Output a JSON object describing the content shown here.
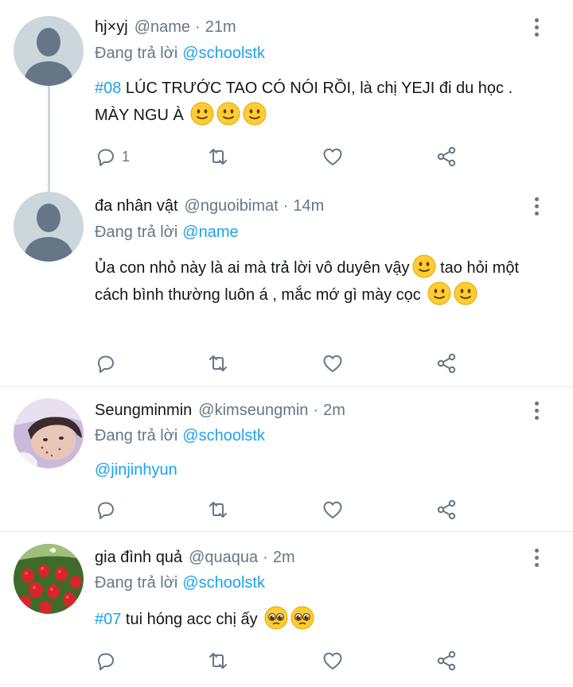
{
  "colors": {
    "accent": "#1da1f2",
    "secondary": "#657786",
    "divider": "#e6ecf0"
  },
  "tweets": [
    {
      "name": "hj×yj",
      "handle": "@name",
      "sep": "·",
      "time": "21m",
      "reply_prefix": "Đang trả lời",
      "reply_to": "@schoolstk",
      "tag": "#08",
      "text": " LÚC TRƯỚC TAO CÓ NÓI RỒI,  là chị YEJI đi du học .  MÀY NGU À ",
      "emojis": [
        "slightly-smiling-face",
        "slightly-smiling-face",
        "slightly-smiling-face"
      ],
      "reply_count": "1",
      "avatar": "default-avatar"
    },
    {
      "name": "đa nhân vật",
      "handle": "@nguoibimat",
      "sep": "·",
      "time": "14m",
      "reply_prefix": "Đang trả lời",
      "reply_to": "@name",
      "text_1": "Ủa con nhỏ này là ai mà trả lời vô duyên vậy",
      "text_2": "  tao hỏi một cách bình thường luôn á ,  mắc mớ gì mày cọc ",
      "emojis": [
        "slightly-smiling-face",
        "slightly-smiling-face",
        "slightly-smiling-face"
      ],
      "avatar": "default-avatar"
    },
    {
      "name": "Seungminmin",
      "handle": "@kimseungmin",
      "sep": "·",
      "time": "2m",
      "reply_prefix": "Đang trả lời",
      "reply_to": "@schoolstk",
      "text": "@jinjinhyun",
      "avatar": "photo-avatar-person"
    },
    {
      "name": "gia đình quả",
      "handle": "@quaqua",
      "sep": "·",
      "time": "2m",
      "reply_prefix": "Đang trả lời",
      "reply_to": "@schoolstk",
      "tag": "#07",
      "text": "   tui hóng acc chị ấy ",
      "emojis": [
        "pleading-face",
        "pleading-face"
      ],
      "avatar": "photo-avatar-strawberries"
    }
  ],
  "icons": {
    "reply": "reply-icon",
    "retweet": "retweet-icon",
    "like": "heart-icon",
    "share": "share-icon",
    "more": "more-options-icon"
  }
}
